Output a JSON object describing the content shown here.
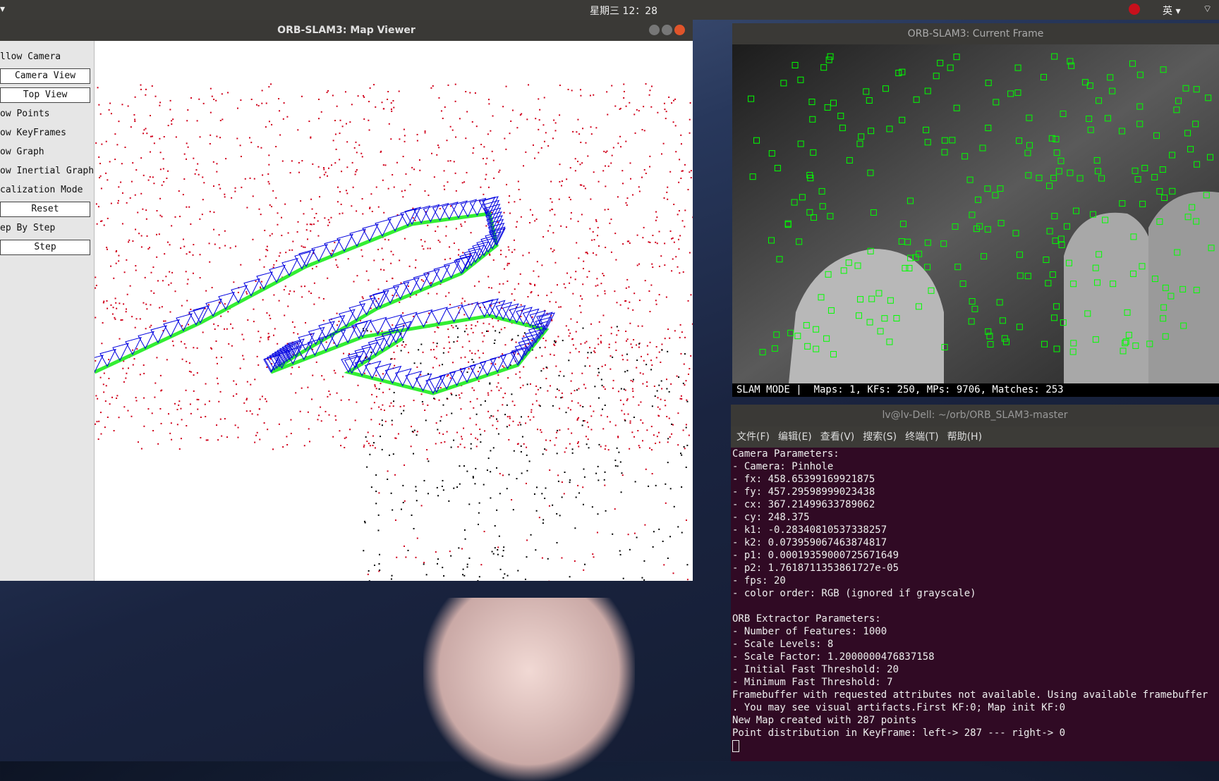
{
  "topbar": {
    "activities": "▾",
    "clock": "星期三 12：28",
    "lang": "英 ▾",
    "net": "⌔"
  },
  "map_viewer": {
    "title": "ORB-SLAM3: Map Viewer",
    "panel": [
      {
        "type": "checkbox",
        "label": "llow Camera"
      },
      {
        "type": "button",
        "label": "Camera View"
      },
      {
        "type": "button",
        "label": "Top View"
      },
      {
        "type": "checkbox",
        "label": "ow Points"
      },
      {
        "type": "checkbox",
        "label": "ow KeyFrames"
      },
      {
        "type": "checkbox",
        "label": "ow Graph"
      },
      {
        "type": "checkbox",
        "label": "ow Inertial Graph"
      },
      {
        "type": "checkbox",
        "label": "calization Mode"
      },
      {
        "type": "button",
        "label": "Reset"
      },
      {
        "type": "checkbox",
        "label": "ep By Step"
      },
      {
        "type": "button",
        "label": "Step"
      }
    ],
    "colors": {
      "points": "#d0001a",
      "ref_points": "#000000",
      "keyframes": "#0000e0",
      "graph": "#33ee33"
    }
  },
  "current_frame": {
    "title": "ORB-SLAM3: Current Frame",
    "status": "SLAM MODE |  Maps: 1, KFs: 250, MPs: 9706, Matches: 253",
    "feature_color": "#00ff00"
  },
  "terminal": {
    "title": "lv@lv-Dell: ~/orb/ORB_SLAM3-master",
    "menu": [
      "文件(F)",
      "编辑(E)",
      "查看(V)",
      "搜索(S)",
      "终端(T)",
      "帮助(H)"
    ],
    "lines": [
      "Camera Parameters:",
      "- Camera: Pinhole",
      "- fx: 458.65399169921875",
      "- fy: 457.29598999023438",
      "- cx: 367.21499633789062",
      "- cy: 248.375",
      "- k1: -0.28340810537338257",
      "- k2: 0.073959067463874817",
      "- p1: 0.00019359000725671649",
      "- p2: 1.7618711353861727e-05",
      "- fps: 20",
      "- color order: RGB (ignored if grayscale)",
      "",
      "ORB Extractor Parameters:",
      "- Number of Features: 1000",
      "- Scale Levels: 8",
      "- Scale Factor: 1.2000000476837158",
      "- Initial Fast Threshold: 20",
      "- Minimum Fast Threshold: 7",
      "Framebuffer with requested attributes not available. Using available framebuffer",
      ". You may see visual artifacts.First KF:0; Map init KF:0",
      "New Map created with 287 points",
      "Point distribution in KeyFrame: left-> 287 --- right-> 0"
    ]
  }
}
